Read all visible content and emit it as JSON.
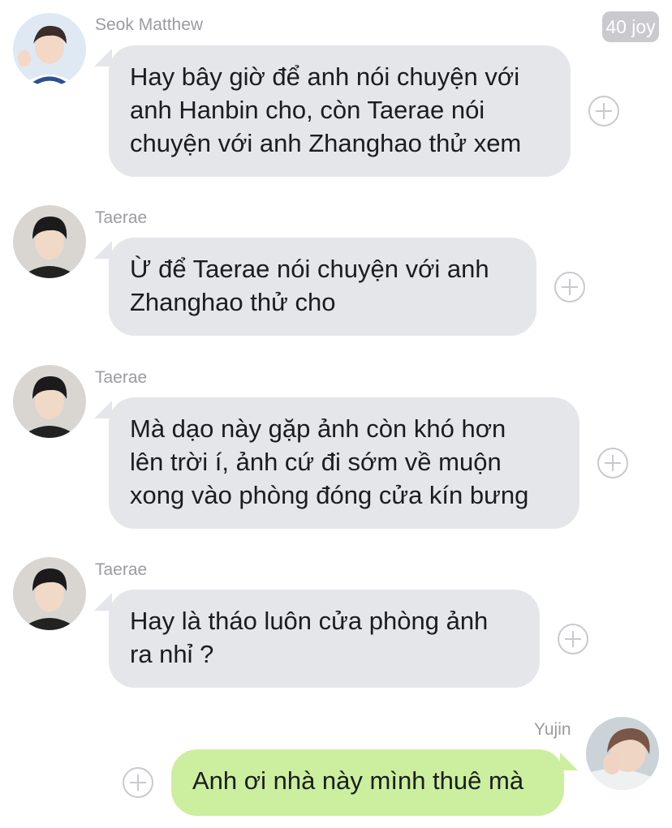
{
  "badge": {
    "label": "40 joy"
  },
  "messages": [
    {
      "sender": "Seok Matthew",
      "avatar": "matthew-avatar",
      "lines": [
        "Hay bây giờ để anh nói chuyện với",
        "anh Hanbin cho, còn Taerae nói",
        "chuyện với anh Zhanghao thử xem"
      ]
    },
    {
      "sender": "Taerae",
      "avatar": "taerae-avatar",
      "lines": [
        "Ừ để Taerae nói chuyện với anh",
        "Zhanghao thử cho"
      ]
    },
    {
      "sender": "Taerae",
      "avatar": "taerae-avatar",
      "lines": [
        "Mà dạo này gặp ảnh còn khó hơn",
        "lên trời í, ảnh cứ đi sớm về muộn",
        "xong vào phòng đóng cửa kín bưng"
      ]
    },
    {
      "sender": "Taerae",
      "avatar": "taerae-avatar",
      "lines": [
        "Hay là tháo luôn cửa phòng ảnh",
        "ra nhỉ ?"
      ]
    },
    {
      "sender": "Yujin",
      "avatar": "yujin-avatar",
      "lines": [
        "Anh ơi nhà này mình thuê mà"
      ]
    }
  ],
  "colors": {
    "incoming_bubble": "#e5e6ea",
    "outgoing_bubble": "#cbef9e",
    "name_text": "#9b9ba0",
    "plus_icon": "#c9c9ce"
  }
}
